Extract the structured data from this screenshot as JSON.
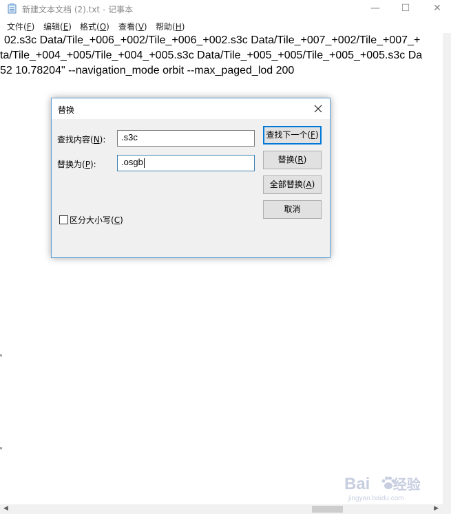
{
  "window": {
    "title": "新建文本文档 (2).txt - 记事本",
    "minimize_glyph": "—",
    "maximize_glyph": "☐",
    "close_glyph": "✕"
  },
  "menu": [
    {
      "label": "文件(",
      "key": "F",
      "suffix": ")"
    },
    {
      "label": "编辑(",
      "key": "E",
      "suffix": ")"
    },
    {
      "label": "格式(",
      "key": "O",
      "suffix": ")"
    },
    {
      "label": "查看(",
      "key": "V",
      "suffix": ")"
    },
    {
      "label": "帮助(",
      "key": "H",
      "suffix": ")"
    }
  ],
  "editor": {
    "lines": [
      "02.s3c Data/Tile_+006_+002/Tile_+006_+002.s3c Data/Tile_+007_+002/Tile_+007_+",
      "ta/Tile_+004_+005/Tile_+004_+005.s3c Data/Tile_+005_+005/Tile_+005_+005.s3c Da",
      "52 10.78204\" --navigation_mode orbit --max_paged_lod 200"
    ]
  },
  "dialog": {
    "title": "替换",
    "find_label": {
      "text": "查找内容(",
      "key": "N",
      "suffix": "):"
    },
    "find_value": ".s3c",
    "replace_label": {
      "text": "替换为(",
      "key": "P",
      "suffix": "):"
    },
    "replace_value": ".osgb",
    "buttons": {
      "find_next": {
        "text": "查找下一个(",
        "key": "F",
        "suffix": ")"
      },
      "replace": {
        "text": "替换(",
        "key": "R",
        "suffix": ")"
      },
      "replace_all": {
        "text": "全部替换(",
        "key": "A",
        "suffix": ")"
      },
      "cancel": {
        "text": "取消"
      }
    },
    "match_case": {
      "text": "区分大小写(",
      "key": "C",
      "suffix": ")",
      "checked": false
    }
  },
  "watermark": {
    "logo_left": "Bai",
    "logo_right": "经验",
    "sub": "jingyan.baidu.com"
  },
  "colors": {
    "dialog_border": "#5a9fd6",
    "default_button_border": "#0078d7"
  }
}
